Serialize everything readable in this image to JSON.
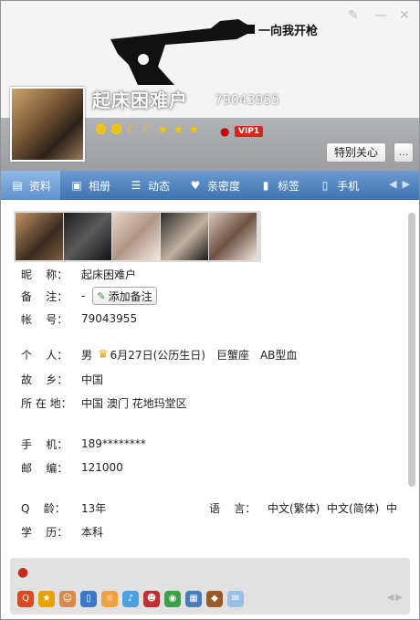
{
  "header": {
    "slogan": "一向我开枪",
    "nickname": "起床困难户",
    "qq_number": "79043955",
    "vip_label": "VIP1",
    "level_icons": [
      "smile-icon",
      "smile-icon",
      "moon-icon",
      "moon-icon",
      "star-icon",
      "star-icon",
      "star-icon"
    ],
    "special_care_label": "特别关心",
    "message_icon": "chat-bubble-icon"
  },
  "tabs": [
    {
      "label": "资料",
      "icon": "profile-card-icon",
      "active": true
    },
    {
      "label": "相册",
      "icon": "photo-album-icon",
      "active": false
    },
    {
      "label": "动态",
      "icon": "feed-list-icon",
      "active": false
    },
    {
      "label": "亲密度",
      "icon": "heart-icon",
      "active": false
    },
    {
      "label": "标签",
      "icon": "bookmark-icon",
      "active": false
    },
    {
      "label": "手机",
      "icon": "phone-icon",
      "active": false
    }
  ],
  "profile": {
    "nickname_label": "昵    称：",
    "nickname_value": "起床困难户",
    "remark_label": "备    注：",
    "remark_value": "-",
    "add_remark_label": "添加备注",
    "account_label": "帐    号：",
    "account_value": "79043955",
    "personal_label": "个    人：",
    "gender": "男",
    "birthday": "6月27日(公历生日)",
    "zodiac": "巨蟹座",
    "blood": "AB型血",
    "hometown_label": "故    乡：",
    "hometown": "中国",
    "location_label": "所 在 地：",
    "location": "中国 澳门 花地玛堂区",
    "mobile_label": "手    机：",
    "mobile": "189********",
    "zip_label": "邮    编：",
    "zip": "121000",
    "age_label": "Q    龄：",
    "age": "13年",
    "language_label": "语    言：",
    "language": "中文(繁体)  中文(简体)  中",
    "education_label": "学    历：",
    "education": "本科"
  },
  "colors": {
    "tab_bar": "#4a7dbb",
    "vip_red": "#d3281b",
    "band_grey": "#a4a6aa"
  }
}
